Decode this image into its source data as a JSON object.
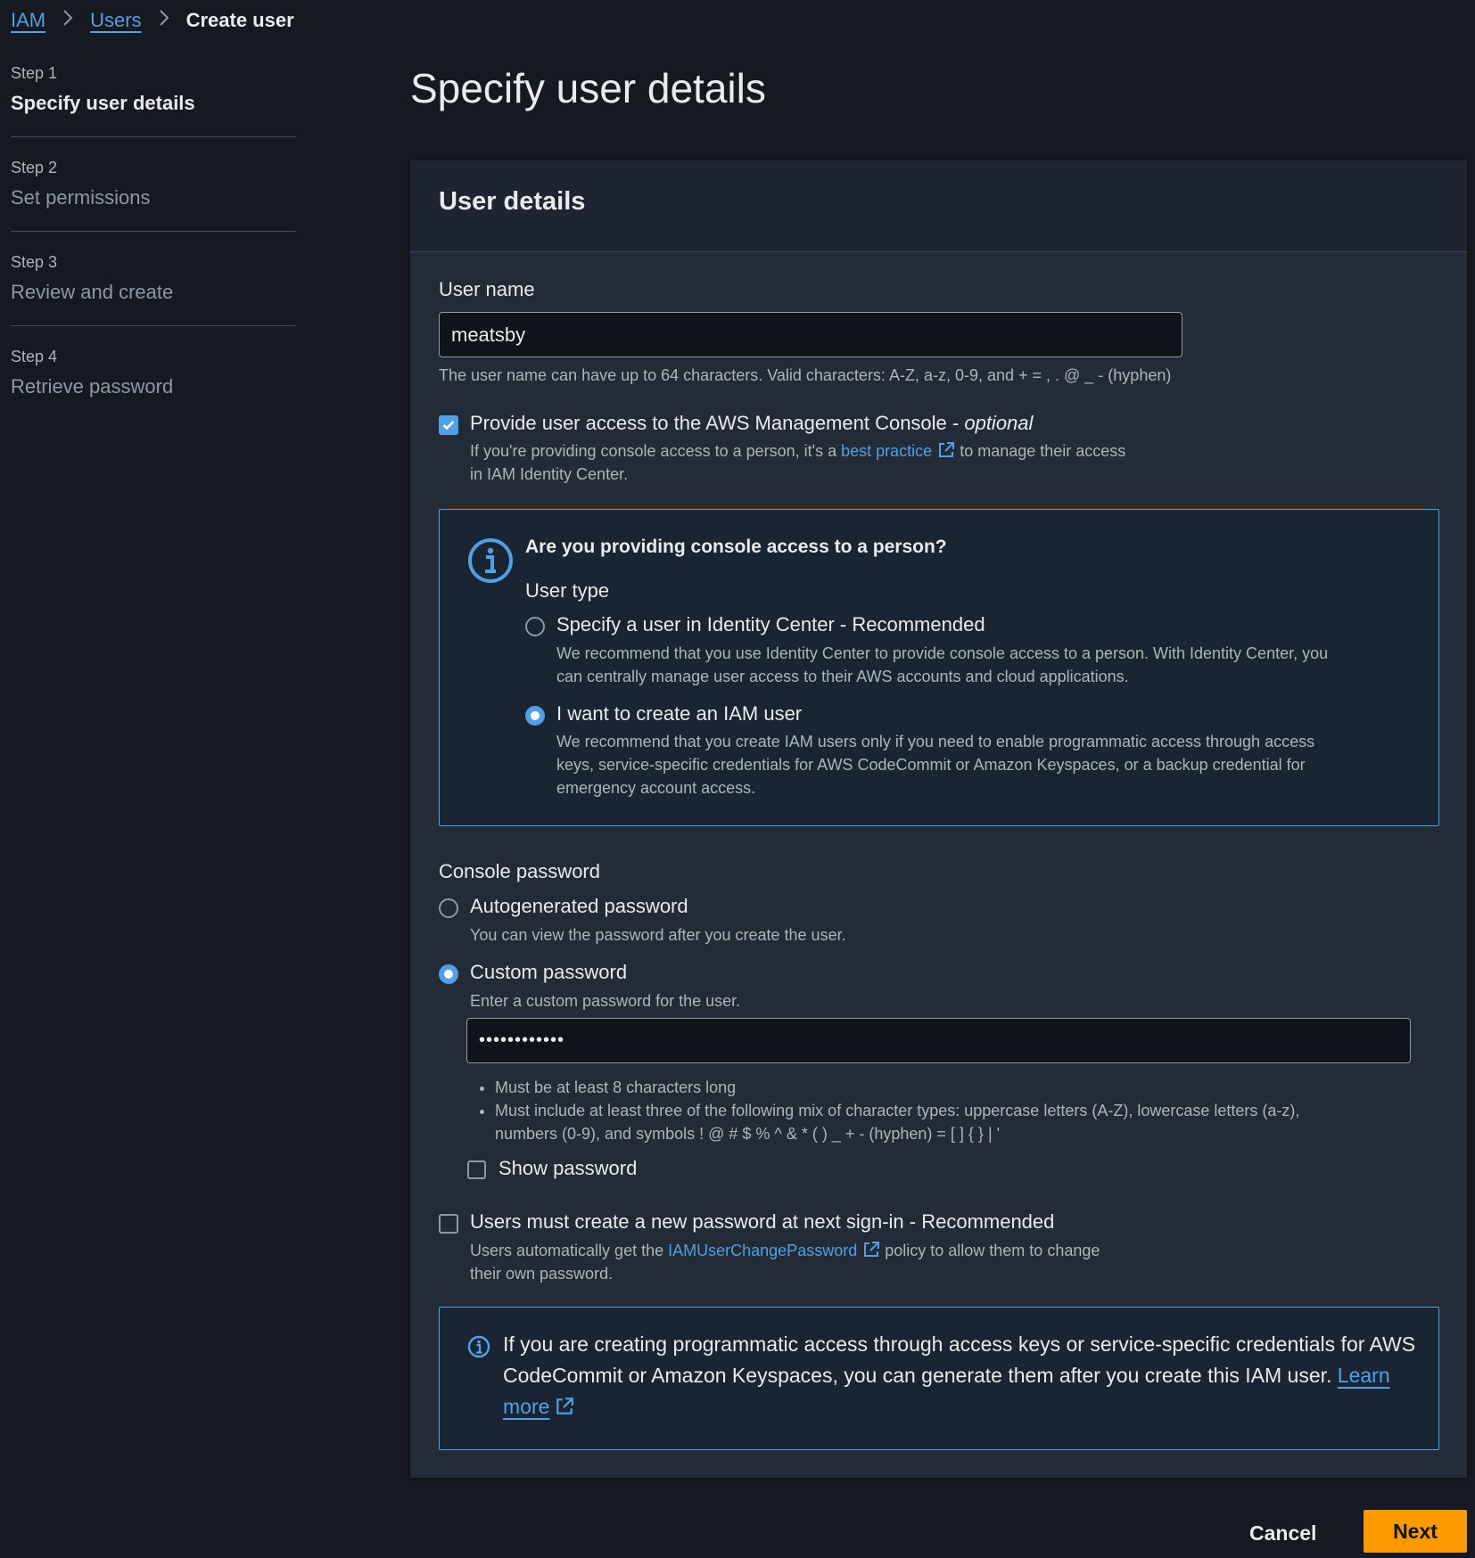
{
  "breadcrumb": {
    "items": [
      "IAM",
      "Users"
    ],
    "current": "Create user"
  },
  "steps": [
    {
      "num": "Step 1",
      "title": "Specify user details"
    },
    {
      "num": "Step 2",
      "title": "Set permissions"
    },
    {
      "num": "Step 3",
      "title": "Review and create"
    },
    {
      "num": "Step 4",
      "title": "Retrieve password"
    }
  ],
  "page_title": "Specify user details",
  "panel": {
    "title": "User details",
    "username": {
      "label": "User name",
      "value": "meatsby",
      "hint": "The user name can have up to 64 characters. Valid characters: A-Z, a-z, 0-9, and + = , . @ _ - (hyphen)"
    },
    "console_access": {
      "label": "Provide user access to the AWS Management Console - ",
      "optional": "optional",
      "desc_before": "If you're providing console access to a person, it's a",
      "link": "best practice",
      "desc_after": "to manage their access",
      "desc_line2": "in IAM Identity Center.",
      "checked": true
    },
    "person_box": {
      "title": "Are you providing console access to a person?",
      "user_type_label": "User type",
      "option1": {
        "label": "Specify a user in Identity Center - Recommended",
        "desc1": "We recommend that you use Identity Center to provide console access to a person. With Identity Center, you",
        "desc2": "can centrally manage user access to their AWS accounts and cloud applications."
      },
      "option2": {
        "label": "I want to create an IAM user",
        "desc1": "We recommend that you create IAM users only if you need to enable programmatic access through access",
        "desc2": "keys, service-specific credentials for AWS CodeCommit or Amazon Keyspaces, or a backup credential for",
        "desc3": "emergency account access."
      }
    },
    "password": {
      "label": "Console password",
      "auto_label": "Autogenerated password",
      "auto_desc": "You can view the password after you create the user.",
      "custom_label": "Custom password",
      "custom_desc": "Enter a custom password for the user.",
      "value": "••••••••••••",
      "req1": "Must be at least 8 characters long",
      "req2a": "Must include at least three of the following mix of character types: uppercase letters (A-Z), lowercase letters (a-z),",
      "req2b": "numbers (0-9), and symbols ! @ # $ % ^ & * ( ) _ + - (hyphen) = [ ] { } | '",
      "show_label": "Show password"
    },
    "reset": {
      "label": "Users must create a new password at next sign-in - Recommended",
      "desc_before": "Users automatically get the",
      "link": "IAMUserChangePassword",
      "desc_after": "policy to allow them to change",
      "desc_line2": "their own password."
    },
    "programmatic_box": {
      "line1": "If you are creating programmatic access through access keys or service-specific credentials for AWS",
      "line2": "CodeCommit or Amazon Keyspaces, you can generate them after you create this IAM user.",
      "link1": "Learn",
      "link2": "more"
    }
  },
  "footer": {
    "cancel": "Cancel",
    "next": "Next"
  },
  "colors": {
    "accent": "#539fe5",
    "primary_button": "#ff9900",
    "background": "#16191f",
    "panel": "#232b37"
  }
}
